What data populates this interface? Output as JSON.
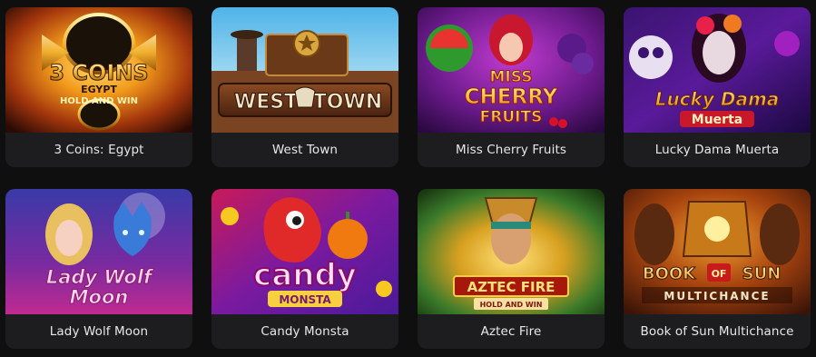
{
  "games": [
    {
      "title": "3 Coins: Egypt",
      "logo_lines": [
        "3 COINS",
        "EGYPT",
        "HOLD AND WIN"
      ],
      "theme": "gold-fire"
    },
    {
      "title": "West Town",
      "logo_lines": [
        "WEST",
        "TOWN"
      ],
      "theme": "western"
    },
    {
      "title": "Miss Cherry Fruits",
      "logo_lines": [
        "MISS",
        "CHERRY",
        "FRUITS"
      ],
      "theme": "fruits"
    },
    {
      "title": "Lucky Dama Muerta",
      "logo_lines": [
        "Lucky Dama",
        "Muerta"
      ],
      "theme": "day-of-dead"
    },
    {
      "title": "Lady Wolf Moon",
      "logo_lines": [
        "Lady Wolf",
        "Moon"
      ],
      "theme": "wolf-moon"
    },
    {
      "title": "Candy Monsta",
      "logo_lines": [
        "candy",
        "MONSTA"
      ],
      "theme": "candy"
    },
    {
      "title": "Aztec Fire",
      "logo_lines": [
        "AZTEC FIRE",
        "HOLD AND WIN"
      ],
      "theme": "aztec"
    },
    {
      "title": "Book of Sun Multichance",
      "logo_lines": [
        "BOOK",
        "OF",
        "SUN",
        "MULTICHANCE"
      ],
      "theme": "book-sun"
    }
  ],
  "colors": {
    "page_bg": "#0f0f10",
    "card_bg": "#1d1d1f",
    "label_text": "#e8e8e8"
  }
}
